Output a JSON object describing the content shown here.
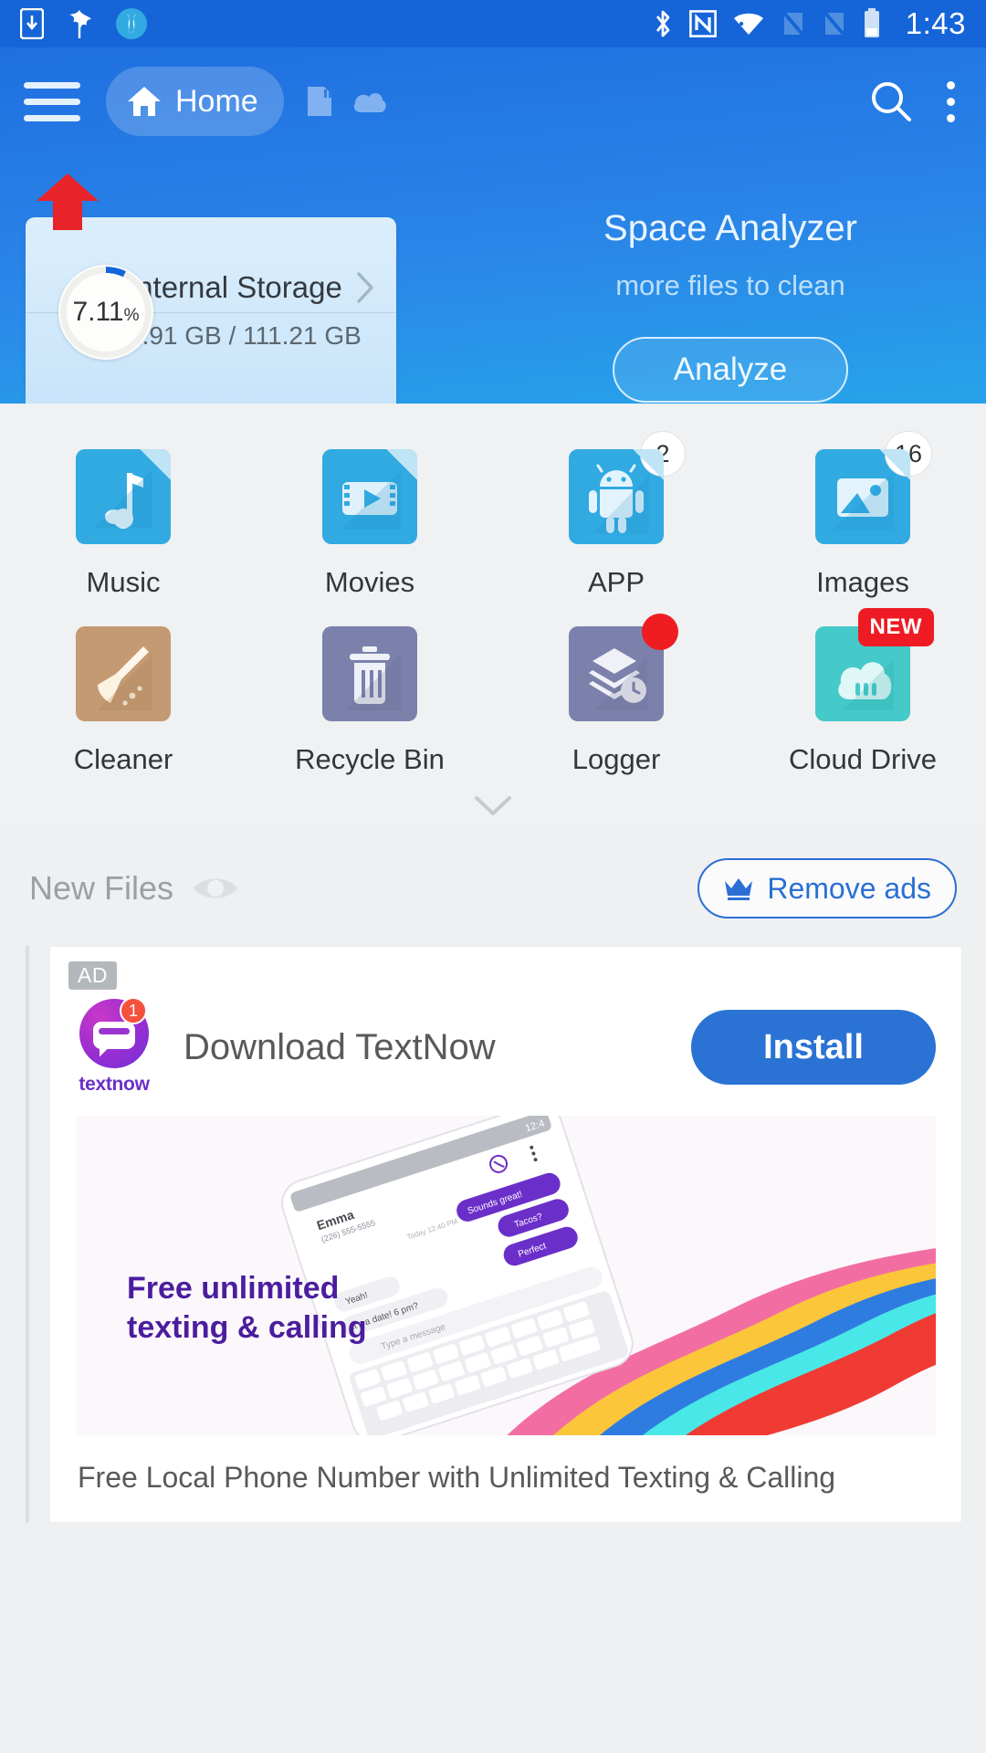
{
  "statusbar": {
    "icons_left": [
      "sim-download-icon",
      "leaf-icon",
      "app-logo-icon"
    ],
    "icons_right": [
      "bluetooth-icon",
      "nfc-icon",
      "wifi-icon",
      "sim1-off-icon",
      "sim2-off-icon",
      "battery-icon"
    ],
    "time": "1:43",
    "background": "#1565d8"
  },
  "appbar": {
    "menu_icon": "hamburger-menu-icon",
    "home_label": "Home",
    "home_icon": "home-icon",
    "tab_icons": [
      "sdcard-icon",
      "cloud-icon"
    ],
    "search_icon": "search-icon",
    "overflow_icon": "more-vertical-icon",
    "arrow_annotation": "red-up-arrow"
  },
  "storage_card": {
    "percent": "7.11",
    "percent_symbol": "%",
    "title": "Internal Storage",
    "chevron": "chevron-right-icon",
    "usage": "7.91 GB / 111.21 GB",
    "ring_fill_deg": 26,
    "ring_color": "#1565d8"
  },
  "analyzer": {
    "title": "Space Analyzer",
    "subtitle": "more files to clean",
    "button_label": "Analyze"
  },
  "grid": {
    "rows": [
      [
        {
          "label": "Music",
          "icon": "music-note-file-icon",
          "color": "blue",
          "badge": null,
          "badge_type": null
        },
        {
          "label": "Movies",
          "icon": "video-file-icon",
          "color": "blue",
          "badge": null,
          "badge_type": null
        },
        {
          "label": "APP",
          "icon": "android-robot-icon",
          "color": "blue",
          "badge": "2",
          "badge_type": "count"
        },
        {
          "label": "Images",
          "icon": "photo-file-icon",
          "color": "blue",
          "badge": "16",
          "badge_type": "count"
        }
      ],
      [
        {
          "label": "Cleaner",
          "icon": "broom-icon",
          "color": "tan",
          "badge": null,
          "badge_type": null
        },
        {
          "label": "Recycle Bin",
          "icon": "trash-bin-icon",
          "color": "slate",
          "badge": null,
          "badge_type": null
        },
        {
          "label": "Logger",
          "icon": "layers-clock-icon",
          "color": "slate",
          "badge": "",
          "badge_type": "dot"
        },
        {
          "label": "Cloud Drive",
          "icon": "cloud-icon",
          "color": "teal",
          "badge": "NEW",
          "badge_type": "new"
        }
      ]
    ],
    "expander_icon": "chevron-down-icon"
  },
  "new_files": {
    "title": "New Files",
    "eye_icon": "eye-icon",
    "remove_ads_label": "Remove ads",
    "crown_icon": "crown-icon",
    "accent": "#2b6fd4"
  },
  "ad": {
    "tag": "AD",
    "logo_wordmark": "textnow",
    "logo_badge": "1",
    "headline": "Download TextNow",
    "install_label": "Install",
    "banner_line1": "Free unlimited",
    "banner_line2": "texting & calling",
    "footer": "Free Local Phone Number with Unlimited Texting & Calling",
    "phone_contact": "Emma",
    "phone_number": "(226) 555-5555",
    "phone_bubble_1": "Yeah!",
    "phone_bubble_2": "It's a date! 6 pm?",
    "phone_bubble_3": "Perfect",
    "phone_bubble_4": "Tacos?",
    "phone_input_placeholder": "Type a message"
  }
}
